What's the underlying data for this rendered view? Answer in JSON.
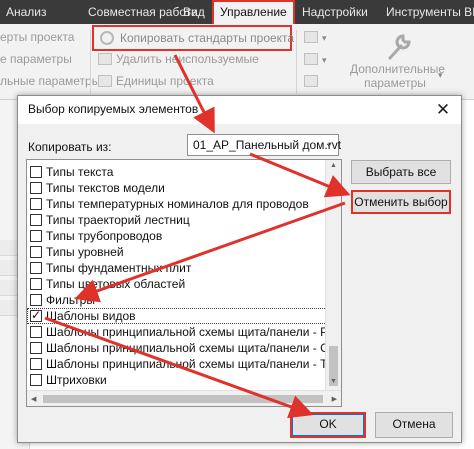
{
  "ribbon": {
    "tabs": [
      "Анализ",
      "Совместная работа",
      "Вид",
      "Управление",
      "Надстройки",
      "Инструменты BIM"
    ],
    "active_tab": "Управление",
    "items": {
      "project_params": "ерты проекта",
      "general_params": "е параметры",
      "general_params2": "льные параметры",
      "copy_standards": "Копировать стандарты проекта",
      "purge_unused": "Удалить неиспользуемые",
      "project_units": "Единицы проекта",
      "additional_settings_line1": "Дополнительные",
      "additional_settings_line2": "параметры"
    },
    "accent_color": "#e0312b"
  },
  "dialog": {
    "title": "Выбор копируемых элементов",
    "close_glyph": "✕",
    "copy_from_label": "Копировать из:",
    "copy_from_value": "01_АР_Панельный дом.rvt",
    "items": [
      {
        "label": "Типы текста",
        "checked": false
      },
      {
        "label": "Типы текстов модели",
        "checked": false
      },
      {
        "label": "Типы температурных номиналов для проводов",
        "checked": false
      },
      {
        "label": "Типы траекторий лестниц",
        "checked": false
      },
      {
        "label": "Типы трубопроводов",
        "checked": false
      },
      {
        "label": "Типы уровней",
        "checked": false
      },
      {
        "label": "Типы фундаментных плит",
        "checked": false
      },
      {
        "label": "Типы цветовых областей",
        "checked": false
      },
      {
        "label": "Фильтры",
        "checked": false
      },
      {
        "label": "Шаблоны видов",
        "checked": true
      },
      {
        "label": "Шаблоны принципиальной схемы щита/панели - Распреде",
        "checked": false
      },
      {
        "label": "Шаблоны принципиальной схемы щита/панели - Силовой",
        "checked": false
      },
      {
        "label": "Шаблоны принципиальной схемы щита/панели - Телеком",
        "checked": false
      },
      {
        "label": "Штриховки",
        "checked": false
      }
    ],
    "select_all_label": "Выбрать все",
    "deselect_label": "Отменить выбор",
    "ok_label": "OK",
    "cancel_label": "Отмена"
  }
}
